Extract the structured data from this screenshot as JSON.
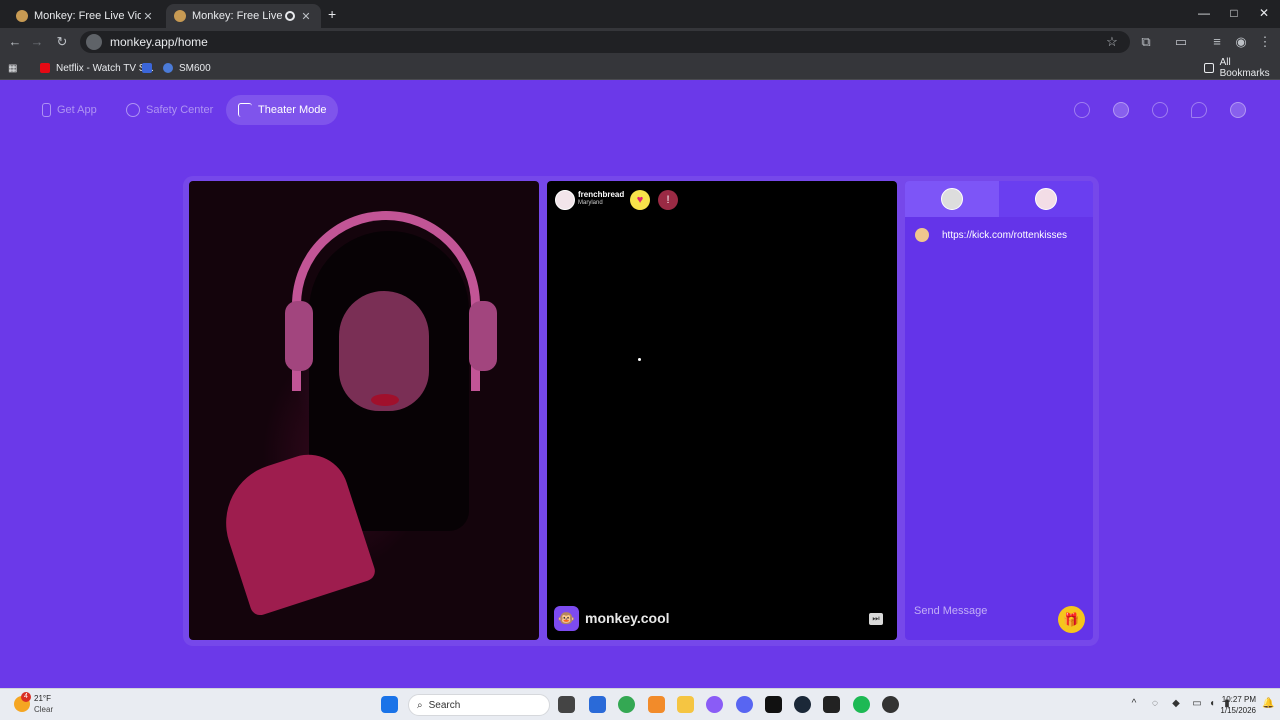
{
  "browser": {
    "tabs": [
      {
        "title": "Monkey: Free Live Video Chat",
        "close": "✕"
      },
      {
        "title": "Monkey: Free Live Video Ch",
        "close": "✕"
      }
    ],
    "new_tab": "+",
    "window_controls": {
      "minimize": "—",
      "maximize": "□",
      "close": "✕"
    },
    "url": "monkey.app/home",
    "bookmarks": [
      {
        "label": "Netflix - Watch TV S...",
        "icon": "netflix-icon"
      },
      {
        "label": "",
        "icon": "bookmark-icon"
      },
      {
        "label": "SM600",
        "icon": "bookmark-icon"
      }
    ],
    "all_bookmarks": "All Bookmarks"
  },
  "page": {
    "nav": {
      "get_app": "Get App",
      "safety_center": "Safety Center",
      "theater_mode": "Theater Mode"
    },
    "stranger": {
      "name": "frenchbread",
      "location": "Maryland"
    },
    "watermark": "monkey.cool",
    "chat": {
      "messages": [
        {
          "text": "https://kick.com/rottenkisses"
        }
      ],
      "input_placeholder": "Send Message"
    },
    "colors": {
      "background": "#6b39e9",
      "chat_panel": "#6434e9",
      "active_chat_tab": "#7d55f7",
      "gift_button": "#f6c51c"
    }
  },
  "taskbar": {
    "weather": {
      "temp": "21°F",
      "desc": "Clear",
      "badge": "4"
    },
    "search": "Search",
    "time": "10:27 PM",
    "date": "1/15/2026"
  }
}
